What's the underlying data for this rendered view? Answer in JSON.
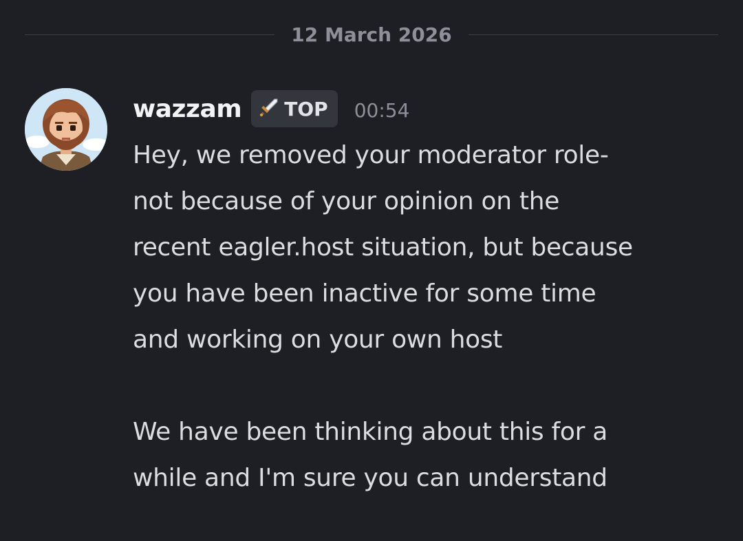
{
  "date_divider": "12 March 2026",
  "message": {
    "author": "wazzam",
    "role_tag": {
      "icon": "sword-icon",
      "label": "TOP"
    },
    "time": "00:54",
    "lines": [
      "Hey, we removed your moderator role-",
      "not because of your opinion on the",
      "recent eagler.host situation, but because",
      "you have been inactive for some time",
      "and working on your own host",
      "",
      "We have been thinking about this for a",
      "while and I'm sure you can understand"
    ]
  },
  "colors": {
    "background": "#1e1f24",
    "text": "#dcdde1",
    "muted": "#8e9099",
    "tag_bg": "#34363e"
  }
}
